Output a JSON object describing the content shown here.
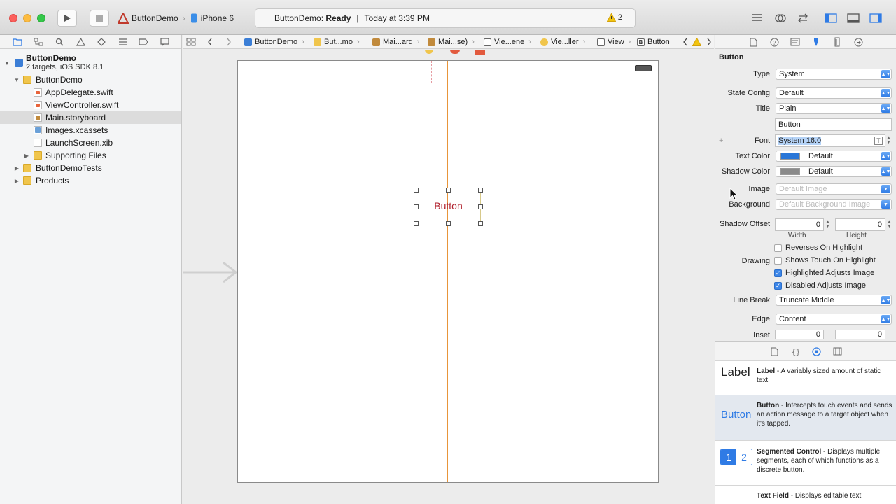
{
  "toolbar": {
    "scheme_project": "ButtonDemo",
    "scheme_device": "iPhone 6",
    "activity_project": "ButtonDemo:",
    "activity_status": "Ready",
    "activity_separator": "|",
    "activity_time": "Today at 3:39 PM",
    "warning_count": "2"
  },
  "navigator": {
    "project_name": "ButtonDemo",
    "project_sub": "2 targets, iOS SDK 8.1",
    "items": [
      {
        "label": "ButtonDemo"
      },
      {
        "label": "AppDelegate.swift"
      },
      {
        "label": "ViewController.swift"
      },
      {
        "label": "Main.storyboard"
      },
      {
        "label": "Images.xcassets"
      },
      {
        "label": "LaunchScreen.xib"
      },
      {
        "label": "Supporting Files"
      },
      {
        "label": "ButtonDemoTests"
      },
      {
        "label": "Products"
      }
    ]
  },
  "jumpbar": {
    "crumbs": [
      "ButtonDemo",
      "But...mo",
      "Mai...ard",
      "Mai...se)",
      "Vie...ene",
      "Vie...ller",
      "View",
      "Button"
    ]
  },
  "canvas": {
    "button_title": "Button"
  },
  "inspector": {
    "section_title": "Button",
    "type_label": "Type",
    "type_value": "System",
    "state_label": "State Config",
    "state_value": "Default",
    "title_label": "Title",
    "title_value": "Plain",
    "title_text": "Button",
    "font_label": "Font",
    "font_value": "System 16.0",
    "textcolor_label": "Text Color",
    "textcolor_value": "Default",
    "shadowcolor_label": "Shadow Color",
    "shadowcolor_value": "Default",
    "image_label": "Image",
    "image_placeholder": "Default Image",
    "background_label": "Background",
    "background_placeholder": "Default Background Image",
    "shadowoffset_label": "Shadow Offset",
    "shadow_width": "0",
    "shadow_height": "0",
    "width_caption": "Width",
    "height_caption": "Height",
    "reverses_label": "Reverses On Highlight",
    "drawing_label": "Drawing",
    "shows_touch_label": "Shows Touch On Highlight",
    "highlighted_adjusts_label": "Highlighted Adjusts Image",
    "disabled_adjusts_label": "Disabled Adjusts Image",
    "linebreak_label": "Line Break",
    "linebreak_value": "Truncate Middle",
    "edge_label": "Edge",
    "edge_value": "Content",
    "inset_label": "Inset",
    "inset_left": "0",
    "inset_right": "0"
  },
  "library": {
    "items": [
      {
        "icon_text": "Label",
        "name": "Label",
        "desc": " - A variably sized amount of static text."
      },
      {
        "icon_text": "Button",
        "name": "Button",
        "desc": " - Intercepts touch events and sends an action message to a target object when it's tapped."
      },
      {
        "icon_text_1": "1",
        "icon_text_2": "2",
        "name": "Segmented Control",
        "desc": " - Displays multiple segments, each of which functions as a discrete button."
      },
      {
        "name": "Text Field",
        "desc": " - Displays editable text"
      }
    ]
  },
  "colors": {
    "accent": "#2f7be5",
    "button_title": "#b0202c",
    "guide_line": "#e8953a",
    "text_color_swatch": "#2a77d8",
    "shadow_color_swatch": "#8a8a8a"
  }
}
